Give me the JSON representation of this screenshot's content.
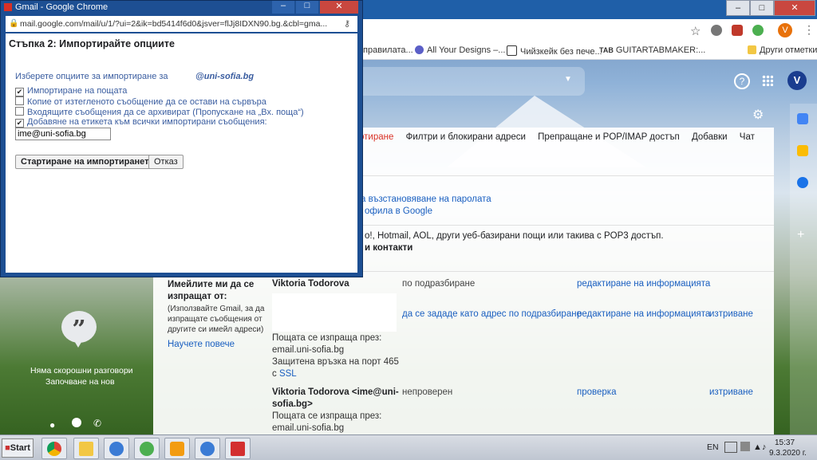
{
  "popup": {
    "window_title": "Gmail - Google Chrome",
    "url": "mail.google.com/mail/u/1/?ui=2&ik=bd5414f6d0&jsver=flJj8IDXN90.bg.&cbl=gma...",
    "heading": "Стъпка 2: Импортирайте опциите",
    "intro": "Изберете опциите за импортиране за",
    "account": "@uni-sofia.bg",
    "options": [
      {
        "label": "Импортиране на пощата",
        "checked": true
      },
      {
        "label": "Копие от изтегленото съобщение да се остави на сървъра",
        "checked": false
      },
      {
        "label": "Входящите съобщения да се архивират (Пропускане на „Вх. поща“)",
        "checked": false
      },
      {
        "label": "Добавяне на етикета към всички импортирани съобщения:",
        "checked": true
      }
    ],
    "label_value": "ime@uni-sofia.bg",
    "start_button": "Стартиране на импортирането",
    "cancel_button": "Отказ",
    "check_glyph": "✔"
  },
  "chrome": {
    "minimize": "–",
    "maximize": "□",
    "close": "✕",
    "star_icon": "☆",
    "avatar_letter": "V",
    "bookmarks": [
      "правилата...",
      "All Your Designs –...",
      "Чийзкейк без пече...",
      "GUITARTABMAKER:...",
      "Други отметки"
    ],
    "bookmark_badge": "TAB"
  },
  "gmail": {
    "avatar_letter": "V",
    "help_glyph": "?",
    "tabs": [
      {
        "label": "ртиране",
        "active": true
      },
      {
        "label": "Филтри и блокирани адреси",
        "active": false
      },
      {
        "label": "Препращане и POP/IMAP достъп",
        "active": false
      },
      {
        "label": "Добавки",
        "active": false
      },
      {
        "label": "Чат",
        "active": false
      }
    ],
    "links": {
      "password_recovery": "а възстановяване на паролата",
      "google_profile": "офила в Google"
    },
    "import_desc": "o!, Hotmail, AOL, други уеб-базирани пощи или такива с POP3 достъп.",
    "import_contacts": "и контакти",
    "send_as": {
      "heading": "Имейлите ми да се изпращат от:",
      "subtext": "(Използвайте Gmail, за да изпращате съобщения от другите си имейл адреси)",
      "learn_more": "Научете повече",
      "row1": {
        "name": "Viktoria Todorova",
        "status": "по подразбиране",
        "edit": "редактиране на информацията"
      },
      "row2": {
        "make_default": "да се зададе като адрес по подразбиране",
        "edit": "редактиране на информацията",
        "delete": "изтриване",
        "sent_via": "Пощата се изпраща през:",
        "server": "email.uni-sofia.bg",
        "secure": "Защитена връзка на порт 465",
        "with": "с",
        "ssl": "SSL"
      },
      "row3": {
        "name_line1": "Viktoria Todorova <ime@uni-",
        "name_line2": "sofia.bg>",
        "status": "непроверен",
        "verify": "проверка",
        "delete": "изтриване",
        "sent_via": "Пощата се изпраща през:",
        "server": "email.uni-sofia.bg"
      }
    }
  },
  "hangouts": {
    "no_chats": "Няма скорошни разговори",
    "start_new": "Започване на нов"
  },
  "taskbar": {
    "start": "Start",
    "language": "EN",
    "time": "15:37",
    "date": "9.3.2020 г."
  }
}
